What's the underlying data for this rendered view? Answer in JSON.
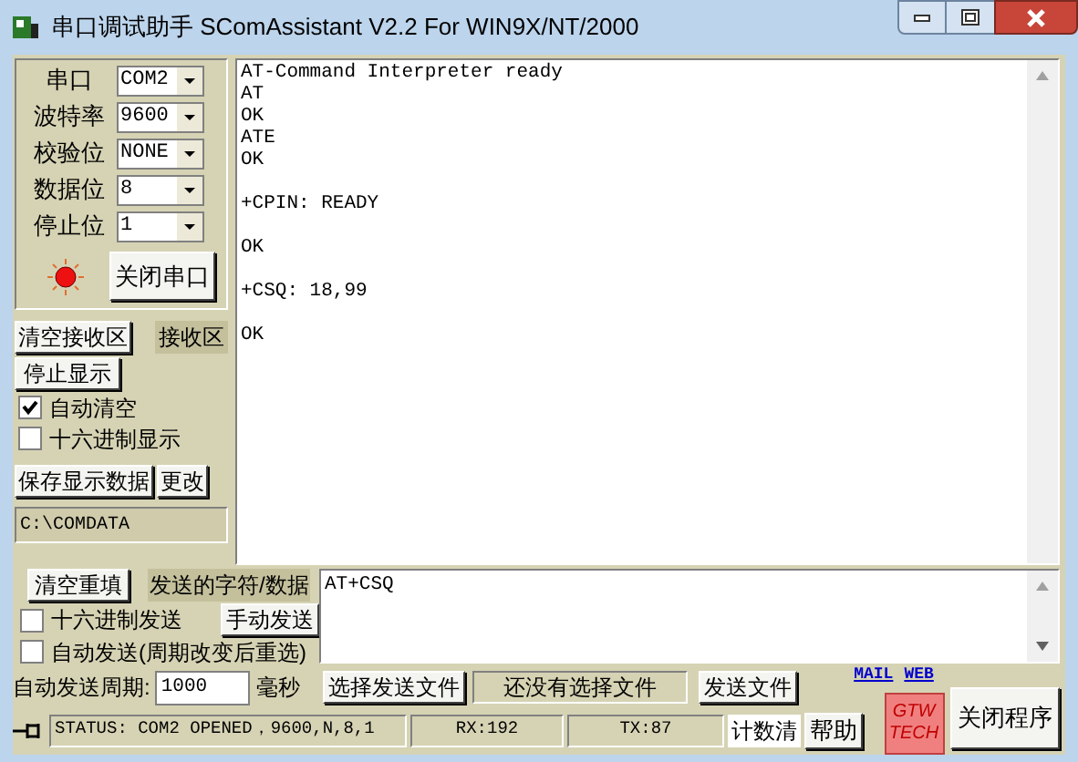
{
  "window": {
    "title": "串口调试助手 SComAssistant V2.2 For WIN9X/NT/2000"
  },
  "serial_settings": [
    {
      "label": "串口",
      "value": "COM2"
    },
    {
      "label": "波特率",
      "value": "9600"
    },
    {
      "label": "校验位",
      "value": "NONE"
    },
    {
      "label": "数据位",
      "value": "8"
    },
    {
      "label": "停止位",
      "value": "1"
    }
  ],
  "status_led": {
    "on": true
  },
  "port_button": "关闭串口",
  "receive": {
    "clear_button": "清空接收区",
    "label": "接收区",
    "stop_button": "停止显示",
    "options": [
      {
        "label": "自动清空",
        "checked": true
      },
      {
        "label": "十六进制显示",
        "checked": false
      }
    ],
    "save_button": "保存显示数据",
    "change_button": "更改",
    "path": "C:\\COMDATA",
    "text": "AT-Command Interpreter ready\nAT\nOK\nATE\nOK\n\n+CPIN: READY\n\nOK\n\n+CSQ: 18,99\n\nOK"
  },
  "send": {
    "clear_button": "清空重填",
    "label": "发送的字符/数据",
    "hex": {
      "label": "十六进制发送",
      "checked": false
    },
    "manual_button": "手动发送",
    "auto": {
      "label": "自动发送(周期改变后重选)",
      "checked": false
    },
    "period_label": "自动发送周期:",
    "period_value": "1000",
    "period_unit": "毫秒",
    "text": "AT+CSQ",
    "select_file_button": "选择发送文件",
    "file_status": "还没有选择文件",
    "send_file_button": "发送文件"
  },
  "links": [
    "MAIL",
    "WEB"
  ],
  "logo": [
    "GTW",
    "TECH"
  ],
  "help_button": "帮助",
  "close_button": "关闭程序",
  "status_bar": {
    "status": "STATUS: COM2 OPENED，9600,N,8,1",
    "rx": "RX:192",
    "tx": "TX:87",
    "reset_button": "计数清"
  }
}
